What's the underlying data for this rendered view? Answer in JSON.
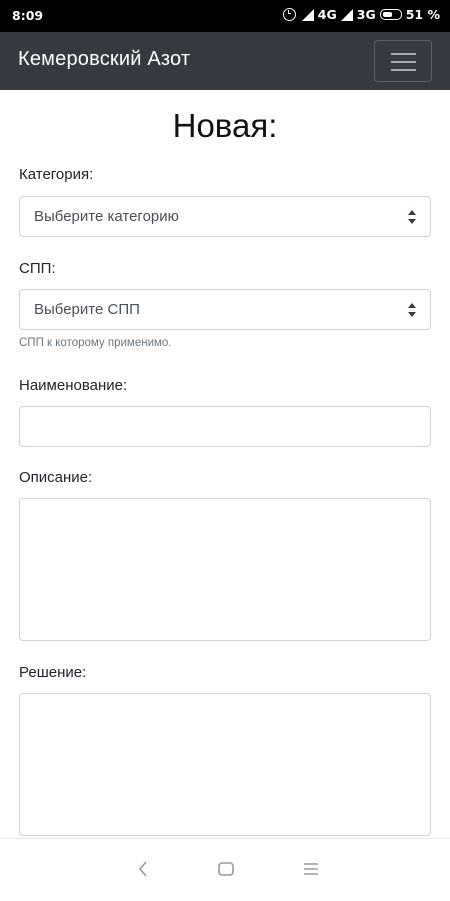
{
  "status_bar": {
    "time": "8:09",
    "net1": "4G",
    "net2": "3G",
    "battery": "51 %",
    "icons": [
      "alarm-icon",
      "signal-icon",
      "signal-icon",
      "battery-icon"
    ]
  },
  "navbar": {
    "brand": "Кемеровский Азот",
    "menu_icon": "hamburger-icon"
  },
  "page": {
    "title": "Новая:"
  },
  "form": {
    "category": {
      "label": "Категория:",
      "selected": "Выберите категорию"
    },
    "spp": {
      "label": "СПП:",
      "selected": "Выберите СПП",
      "help": "СПП к которому применимо."
    },
    "name": {
      "label": "Наименование:",
      "value": ""
    },
    "description": {
      "label": "Описание:",
      "value": ""
    },
    "solution": {
      "label": "Решение:",
      "value": ""
    }
  },
  "system_nav": {
    "icons": [
      "back-icon",
      "home-icon",
      "recent-apps-icon"
    ]
  }
}
